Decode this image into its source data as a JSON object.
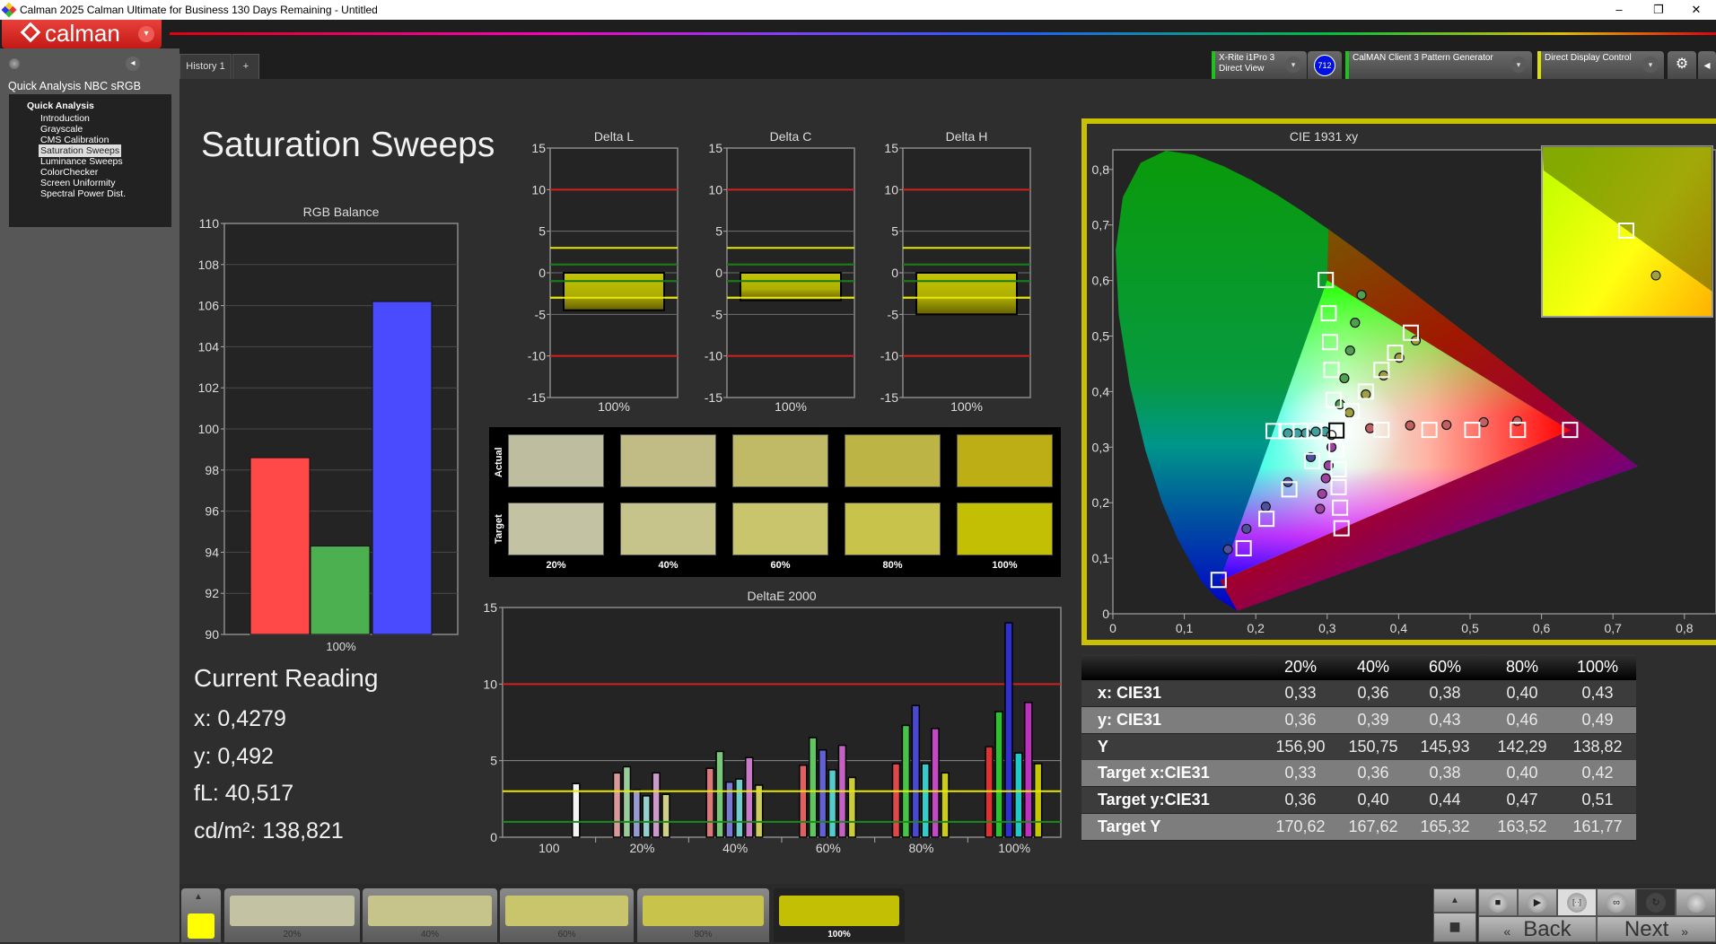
{
  "window": {
    "title": "Calman 2025 Calman Ultimate for Business 130 Days Remaining  - Untitled",
    "minimize": "–",
    "maximize": "❐",
    "close": "✕"
  },
  "logo": {
    "text": "calman",
    "dropdown": "▾"
  },
  "sidebar": {
    "collapse": "◂",
    "workflow_title": "Quick Analysis NBC sRGB",
    "group": "Quick Analysis",
    "items": [
      "Introduction",
      "Grayscale",
      "CMS Calibration",
      "Saturation Sweeps",
      "Luminance Sweeps",
      "ColorChecker",
      "Screen Uniformity",
      "Spectral Power Dist."
    ],
    "selected_index": 3
  },
  "tabs": {
    "items": [
      "History 1"
    ],
    "add": "+"
  },
  "devices": {
    "meter_line1": "X-Rite i1Pro 3",
    "meter_line2": "Direct View",
    "meter_badge": "712",
    "source": "CalMAN Client 3 Pattern Generator",
    "display": "Direct Display Control",
    "dropdown": "▾",
    "settings": "⚙",
    "collapse": "◂",
    "meter_color": "#20c020",
    "source_color": "#20c020",
    "display_color": "#e0e000"
  },
  "page": {
    "title": "Saturation Sweeps"
  },
  "current_reading": {
    "title": "Current Reading",
    "x": "x: 0,4279",
    "y": "y: 0,492",
    "fl": "fL: 40,517",
    "cd": "cd/m²: 138,821"
  },
  "swatches": {
    "actual_label": "Actual",
    "target_label": "Target",
    "labels": [
      "20%",
      "40%",
      "60%",
      "80%",
      "100%"
    ],
    "actual_colors": [
      "#bfbd9f",
      "#c1bb86",
      "#c0b966",
      "#bdb446",
      "#bcae14"
    ],
    "target_colors": [
      "#c3c3a3",
      "#c6c48a",
      "#c8c56c",
      "#c8c44b",
      "#c3bf04"
    ]
  },
  "table": {
    "headers": [
      "",
      "20%",
      "40%",
      "60%",
      "80%",
      "100%"
    ],
    "rows": [
      {
        "label": "x: CIE31",
        "values": [
          "0,33",
          "0,36",
          "0,38",
          "0,40",
          "0,43"
        ]
      },
      {
        "label": "y: CIE31",
        "values": [
          "0,36",
          "0,39",
          "0,43",
          "0,46",
          "0,49"
        ]
      },
      {
        "label": "Y",
        "values": [
          "156,90",
          "150,75",
          "145,93",
          "142,29",
          "138,82"
        ]
      },
      {
        "label": "Target x:CIE31",
        "values": [
          "0,33",
          "0,36",
          "0,38",
          "0,40",
          "0,42"
        ]
      },
      {
        "label": "Target y:CIE31",
        "values": [
          "0,36",
          "0,40",
          "0,44",
          "0,47",
          "0,51"
        ]
      },
      {
        "label": "Target Y",
        "values": [
          "170,62",
          "167,62",
          "165,32",
          "163,52",
          "161,77"
        ]
      }
    ]
  },
  "bottom": {
    "current_color": "#ffff00",
    "steps": [
      {
        "label": "20%",
        "color": "#c3c3a3"
      },
      {
        "label": "40%",
        "color": "#c6c48a"
      },
      {
        "label": "60%",
        "color": "#c8c56c"
      },
      {
        "label": "80%",
        "color": "#c8c44b"
      },
      {
        "label": "100%",
        "color": "#c3bf04"
      }
    ],
    "active_index": 4,
    "up": "▲",
    "stop": "■",
    "play": "▶",
    "bracket": "[··]",
    "loop": "∞",
    "refresh": "↻",
    "back": "Back",
    "next": "Next",
    "back_icon": "«",
    "next_icon": "»"
  },
  "chart_data": [
    {
      "type": "bar",
      "title": "RGB Balance",
      "categories": [
        "100%"
      ],
      "ylim": [
        90,
        110
      ],
      "yticks": [
        "90",
        "92",
        "94",
        "96",
        "98",
        "100",
        "102",
        "104",
        "106",
        "108",
        "110"
      ],
      "series": [
        {
          "color": "#ff4848",
          "values": [
            98.6
          ]
        },
        {
          "color": "#4caf50",
          "values": [
            94.3
          ]
        },
        {
          "color": "#4a4aff",
          "values": [
            106.2
          ]
        }
      ]
    },
    {
      "type": "bar",
      "title": "Delta L",
      "categories": [
        "100%"
      ],
      "ylim": [
        -15,
        15
      ],
      "yticks": [
        "-15",
        "-10",
        "-5",
        "0",
        "5",
        "10",
        "15"
      ],
      "values": [
        -4.5
      ],
      "thresholds": {
        "red": 10,
        "yellow": 3,
        "green": 1
      },
      "color": "#c8c800"
    },
    {
      "type": "bar",
      "title": "Delta C",
      "categories": [
        "100%"
      ],
      "ylim": [
        -15,
        15
      ],
      "yticks": [
        "-15",
        "-10",
        "-5",
        "0",
        "5",
        "10",
        "15"
      ],
      "values": [
        -3.3
      ],
      "thresholds": {
        "red": 10,
        "yellow": 3,
        "green": 1
      },
      "color": "#c8c800"
    },
    {
      "type": "bar",
      "title": "Delta H",
      "categories": [
        "100%"
      ],
      "ylim": [
        -15,
        15
      ],
      "yticks": [
        "-15",
        "-10",
        "-5",
        "0",
        "5",
        "10",
        "15"
      ],
      "values": [
        -5.0
      ],
      "thresholds": {
        "red": 10,
        "yellow": 3,
        "green": 1
      },
      "color": "#c8c800"
    },
    {
      "type": "bar",
      "title": "DeltaE 2000",
      "categories": [
        "100",
        "20%",
        "40%",
        "60%",
        "80%",
        "100%"
      ],
      "ylim": [
        0,
        15
      ],
      "yticks": [
        "0",
        "5",
        "10",
        "15"
      ],
      "thresholds": {
        "red": 10,
        "yellow": 3,
        "green": 1
      },
      "series": [
        {
          "color": "#e03030",
          "values": [
            null,
            4.2,
            4.5,
            4.7,
            4.8,
            5.9
          ]
        },
        {
          "color": "#30c030",
          "values": [
            null,
            4.6,
            5.6,
            6.5,
            7.3,
            8.2
          ]
        },
        {
          "color": "#3030d0",
          "values": [
            null,
            3.1,
            3.6,
            5.7,
            8.6,
            14.0
          ]
        },
        {
          "color": "#20c8c8",
          "values": [
            null,
            2.7,
            3.8,
            4.4,
            4.8,
            5.5
          ]
        },
        {
          "color": "#c030c0",
          "values": [
            null,
            4.2,
            5.2,
            6.0,
            7.1,
            8.8
          ]
        },
        {
          "color": "#c8c800",
          "values": [
            null,
            2.8,
            3.4,
            3.9,
            4.2,
            4.8
          ]
        },
        {
          "color": "#f4f4f4",
          "values": [
            3.5,
            null,
            null,
            null,
            null,
            null
          ]
        }
      ]
    },
    {
      "type": "scatter",
      "title": "CIE 1931 xy",
      "xlim": [
        0,
        0.8
      ],
      "ylim": [
        0,
        0.8
      ],
      "xticks": [
        "0",
        "0,1",
        "0,2",
        "0,3",
        "0,4",
        "0,5",
        "0,6",
        "0,7",
        "0,8"
      ],
      "yticks": [
        "0",
        "0,1",
        "0,2",
        "0,3",
        "0,4",
        "0,5",
        "0,6",
        "0,7",
        "0,8"
      ],
      "gamut": [
        [
          0.64,
          0.33
        ],
        [
          0.3,
          0.6
        ],
        [
          0.15,
          0.06
        ]
      ],
      "targets": {
        "red": [
          [
            0.376,
            0.331
          ],
          [
            0.443,
            0.331
          ],
          [
            0.503,
            0.331
          ],
          [
            0.567,
            0.331
          ],
          [
            0.64,
            0.331
          ]
        ],
        "green": [
          [
            0.309,
            0.385
          ],
          [
            0.306,
            0.439
          ],
          [
            0.304,
            0.489
          ],
          [
            0.302,
            0.541
          ],
          [
            0.298,
            0.601
          ]
        ],
        "blue": [
          [
            0.279,
            0.275
          ],
          [
            0.247,
            0.224
          ],
          [
            0.215,
            0.171
          ],
          [
            0.183,
            0.118
          ],
          [
            0.148,
            0.061
          ]
        ],
        "cyan": [
          [
            0.282,
            0.329
          ],
          [
            0.263,
            0.329
          ],
          [
            0.243,
            0.329
          ],
          [
            0.225,
            0.329
          ]
        ],
        "magenta": [
          [
            0.313,
            0.296
          ],
          [
            0.316,
            0.26
          ],
          [
            0.316,
            0.228
          ],
          [
            0.318,
            0.191
          ],
          [
            0.32,
            0.154
          ]
        ],
        "yellow": [
          [
            0.334,
            0.365
          ],
          [
            0.354,
            0.4
          ],
          [
            0.376,
            0.439
          ],
          [
            0.395,
            0.47
          ],
          [
            0.417,
            0.506
          ]
        ],
        "white": [
          [
            0.313,
            0.33
          ]
        ]
      },
      "measured": {
        "red": [
          [
            0.36,
            0.334
          ],
          [
            0.416,
            0.339
          ],
          [
            0.467,
            0.34
          ],
          [
            0.519,
            0.345
          ],
          [
            0.566,
            0.347
          ]
        ],
        "green": [
          [
            0.318,
            0.377
          ],
          [
            0.324,
            0.424
          ],
          [
            0.332,
            0.474
          ],
          [
            0.339,
            0.524
          ],
          [
            0.348,
            0.574
          ]
        ],
        "blue": [
          [
            0.277,
            0.282
          ],
          [
            0.245,
            0.237
          ],
          [
            0.214,
            0.193
          ],
          [
            0.187,
            0.153
          ],
          [
            0.161,
            0.116
          ]
        ],
        "cyan": [
          [
            0.297,
            0.328
          ],
          [
            0.284,
            0.328
          ],
          [
            0.27,
            0.325
          ],
          [
            0.258,
            0.325
          ],
          [
            0.245,
            0.325
          ]
        ],
        "magenta": [
          [
            0.306,
            0.3
          ],
          [
            0.302,
            0.267
          ],
          [
            0.298,
            0.244
          ],
          [
            0.293,
            0.216
          ],
          [
            0.29,
            0.189
          ]
        ],
        "yellow": [
          [
            0.331,
            0.362
          ],
          [
            0.354,
            0.395
          ],
          [
            0.379,
            0.429
          ],
          [
            0.401,
            0.461
          ],
          [
            0.424,
            0.492
          ]
        ],
        "white": [
          [
            0.306,
            0.322
          ]
        ]
      },
      "point_colors": {
        "red": "#c06060",
        "green": "#50a050",
        "blue": "#5050a0",
        "cyan": "#40a0a0",
        "magenta": "#a040a0",
        "yellow": "#a0a040",
        "white": "#ffffff"
      }
    }
  ]
}
